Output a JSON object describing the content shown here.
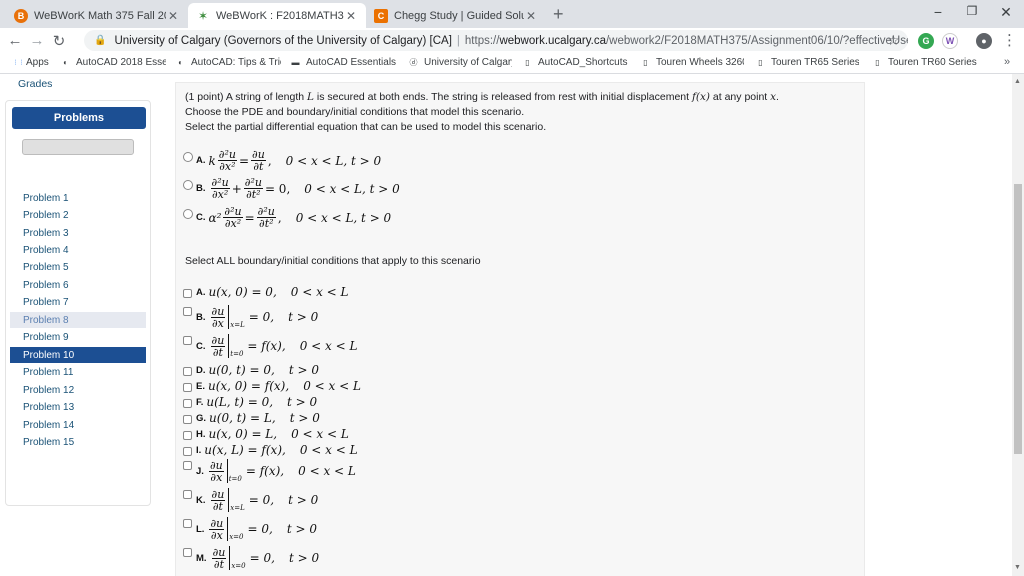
{
  "tabs": [
    {
      "title": "WeBWorK Math 375 Fall 2018 - M",
      "icon": "webwork-icon",
      "glyph": "B",
      "color": "#e8710a"
    },
    {
      "title": "WeBWorK : F2018MATH375 : Ass",
      "icon": "webwork-icon",
      "glyph": "✶",
      "color": "#3c8c3c"
    },
    {
      "title": "Chegg Study | Guided Solutions",
      "icon": "chegg-icon",
      "glyph": "C",
      "color": "#eb7100"
    }
  ],
  "toolbar": {
    "org": "University of Calgary (Governors of the University of Calgary) [CA]",
    "url_prefix": "https://",
    "url_host": "webwork.ucalgary.ca",
    "url_path": "/webwork2/F2018MATH375/Assignment06/10/?effectiveUser=3004..."
  },
  "bookmarks": [
    {
      "label": "Apps",
      "glyph": "⋮⋮⋮",
      "icon": "apps-grid-icon"
    },
    {
      "label": "AutoCAD 2018 Essen",
      "glyph": "◐",
      "icon": "autocad-icon"
    },
    {
      "label": "AutoCAD: Tips & Tric",
      "glyph": "◐",
      "icon": "autocad-icon"
    },
    {
      "label": "AutoCAD Essentials T",
      "glyph": "▬",
      "icon": "video-icon"
    },
    {
      "label": "University of Calgary",
      "glyph": "ⓓ",
      "icon": "ucalgary-icon"
    },
    {
      "label": "AutoCAD_Shortcuts.",
      "glyph": "▯",
      "icon": "page-icon"
    },
    {
      "label": "Touren Wheels 3260",
      "glyph": "▯",
      "icon": "page-icon"
    },
    {
      "label": "Touren TR65 Series W",
      "glyph": "▯",
      "icon": "page-icon"
    },
    {
      "label": "Touren TR60 Series W",
      "glyph": "▯",
      "icon": "page-icon"
    }
  ],
  "page": {
    "grades_link": "Grades",
    "sidebar_header": "Problems",
    "problems": [
      "Problem 1",
      "Problem 2",
      "Problem 3",
      "Problem 4",
      "Problem 5",
      "Problem 6",
      "Problem 7",
      "Problem 8",
      "Problem 9",
      "Problem 10",
      "Problem 11",
      "Problem 12",
      "Problem 13",
      "Problem 14",
      "Problem 15"
    ],
    "visited_problem": "Problem 8",
    "current_problem": "Problem 10"
  },
  "question": {
    "line1_a": "(1 point) A string of length ",
    "line1_L": "L",
    "line1_b": " is secured at both ends. The string is released from rest with initial displacement ",
    "line1_f": "f(x)",
    "line1_c": " at any point ",
    "line1_x": "x",
    "line1_d": ".",
    "line2": "Choose the PDE and boundary/initial conditions that model this scenario.",
    "line3": "Select the partial differential equation that can be used to model this scenario.",
    "line4": "Select ALL boundary/initial conditions that apply to this scenario"
  },
  "pde_options": [
    {
      "label": "A.",
      "lhs_coef": "k",
      "lhs_num": "∂²u",
      "lhs_den": "∂x²",
      "op": "=",
      "rhs_num": "∂u",
      "rhs_den": "∂t",
      "tail": ",",
      "domain": "0 < x < L, t > 0"
    },
    {
      "label": "B.",
      "lhs_coef": "",
      "lhs_num": "∂²u",
      "lhs_den": "∂x²",
      "op": "+",
      "rhs_num": "∂²u",
      "rhs_den": "∂t²",
      "tail": "= 0,",
      "domain": "0 < x < L, t > 0"
    },
    {
      "label": "C.",
      "lhs_coef": "α²",
      "lhs_num": "∂²u",
      "lhs_den": "∂x²",
      "op": "=",
      "rhs_num": "∂²u",
      "rhs_den": "∂t²",
      "tail": ",",
      "domain": "0 < x < L, t > 0"
    }
  ],
  "bc_options": [
    {
      "label": "A.",
      "kind": "plain",
      "expr": "u(x, 0) = 0,",
      "domain": "0 < x < L"
    },
    {
      "label": "B.",
      "kind": "deriv",
      "num": "∂u",
      "den": "∂x",
      "at": "x=L",
      "expr": "= 0,",
      "domain": "t > 0"
    },
    {
      "label": "C.",
      "kind": "deriv",
      "num": "∂u",
      "den": "∂t",
      "at": "t=0",
      "expr": "= f(x),",
      "domain": "0 < x < L"
    },
    {
      "label": "D.",
      "kind": "plain",
      "expr": "u(0, t) = 0,",
      "domain": "t > 0"
    },
    {
      "label": "E.",
      "kind": "plain",
      "expr": "u(x, 0) = f(x),",
      "domain": "0 < x < L"
    },
    {
      "label": "F.",
      "kind": "plain",
      "expr": "u(L, t) = 0,",
      "domain": "t > 0"
    },
    {
      "label": "G.",
      "kind": "plain",
      "expr": "u(0, t) = L,",
      "domain": "t > 0"
    },
    {
      "label": "H.",
      "kind": "plain",
      "expr": "u(x, 0) = L,",
      "domain": "0 < x < L"
    },
    {
      "label": "I.",
      "kind": "plain",
      "expr": "u(x, L) = f(x),",
      "domain": "0 < x < L"
    },
    {
      "label": "J.",
      "kind": "deriv",
      "num": "∂u",
      "den": "∂x",
      "at": "t=0",
      "expr": "= f(x),",
      "domain": "0 < x < L"
    },
    {
      "label": "K.",
      "kind": "deriv",
      "num": "∂u",
      "den": "∂t",
      "at": "x=L",
      "expr": "= 0,",
      "domain": "t > 0"
    },
    {
      "label": "L.",
      "kind": "deriv",
      "num": "∂u",
      "den": "∂x",
      "at": "x=0",
      "expr": "= 0,",
      "domain": "t > 0"
    },
    {
      "label": "M.",
      "kind": "deriv",
      "num": "∂u",
      "den": "∂t",
      "at": "x=0",
      "expr": "= 0,",
      "domain": "t > 0"
    }
  ],
  "colors": {
    "accent": "#1c4f93",
    "link": "#1a5276",
    "tabbar": "#dee1e6"
  }
}
